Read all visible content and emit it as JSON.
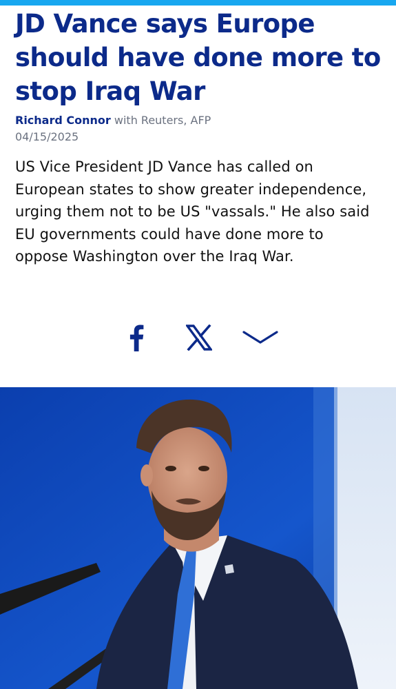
{
  "article": {
    "title": "JD Vance says Europe should have done more to stop Iraq War",
    "author": "Richard Connor",
    "credit": " with Reuters, AFP",
    "date": "04/15/2025",
    "teaser": "US Vice President JD Vance has called on European states to show greater independence, urging them not to be US \"vassals.\" He also said EU governments could have done more to oppose Washington over the Iraq War."
  },
  "share": {
    "items": [
      {
        "icon": "facebook-icon"
      },
      {
        "icon": "x-icon"
      },
      {
        "icon": "chevron-down-icon"
      }
    ]
  },
  "colors": {
    "accent_bar": "#18a7f0",
    "headline": "#0c2a8a",
    "meta": "#6b7280",
    "body": "#111111"
  }
}
